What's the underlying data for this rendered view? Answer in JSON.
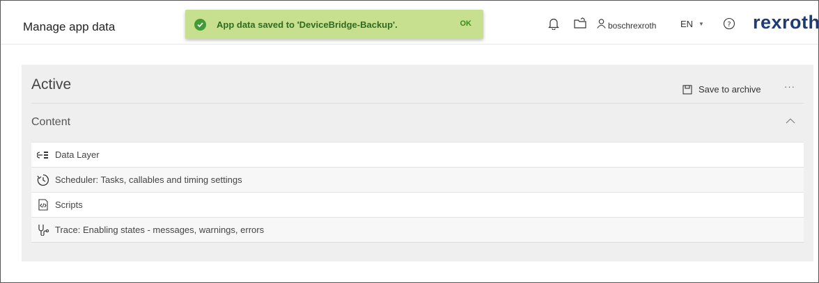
{
  "window": {
    "title": "Manage app data"
  },
  "toast": {
    "message": "App data saved to 'DeviceBridge-Backup'.",
    "ok_label": "OK",
    "icon": "check-circle-icon",
    "color": "#c6e08f"
  },
  "header": {
    "user": "boschrexroth",
    "language": "EN",
    "brand": "rexroth",
    "icons": [
      "bell-icon",
      "folder-icon",
      "user-icon",
      "help-icon"
    ]
  },
  "panel": {
    "title": "Active",
    "save_label": "Save to archive",
    "more_label": "···",
    "section_title": "Content",
    "items": [
      {
        "label": "Data Layer",
        "icon": "data-layer-icon"
      },
      {
        "label": "Scheduler: Tasks, callables and timing settings",
        "icon": "scheduler-icon"
      },
      {
        "label": "Scripts",
        "icon": "scripts-icon"
      },
      {
        "label": "Trace: Enabling states - messages, warnings, errors",
        "icon": "trace-icon"
      }
    ]
  },
  "colors": {
    "brand": "#1f3b73",
    "panel_bg": "#efefef",
    "success": "#3f9c35"
  }
}
